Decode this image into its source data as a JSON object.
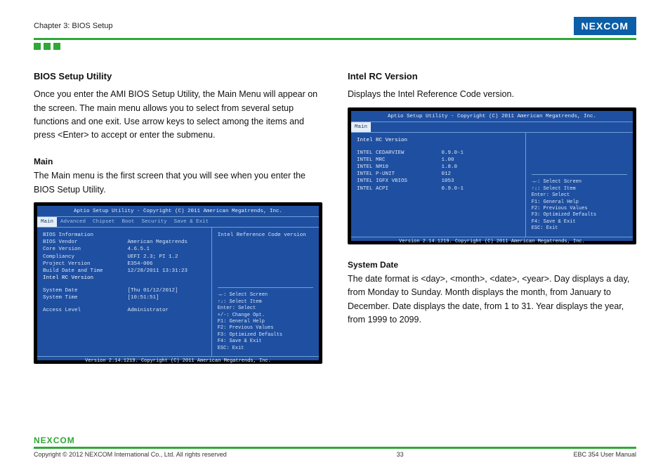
{
  "header": {
    "chapter": "Chapter 3: BIOS Setup",
    "brand": "NE COM",
    "brand_x": "X"
  },
  "left": {
    "title": "BIOS Setup Utility",
    "intro": "Once you enter the AMI BIOS Setup Utility, the Main Menu will appear on the screen. The main menu allows you to select from several setup functions and one exit. Use arrow keys to select among the items and press <Enter> to accept or enter the submenu.",
    "main_h": "Main",
    "main_p": "The Main menu is the first screen that you will see when you enter the BIOS Setup Utility."
  },
  "right": {
    "rc_h": "Intel RC Version",
    "rc_p": "Displays the Intel Reference Code version.",
    "sd_h": "System Date",
    "sd_p": " The date format is <day>, <month>, <date>, <year>. Day displays a day, from Monday to Sunday. Month displays the month, from January to December. Date displays the date, from 1 to 31. Year displays the year, from 1999 to 2099."
  },
  "bios1": {
    "title": "Aptio Setup Utility - Copyright (C) 2011 American Megatrends, Inc.",
    "tabs": [
      "Main",
      "Advanced",
      "Chipset",
      "Boot",
      "Security",
      "Save & Exit"
    ],
    "rows": [
      {
        "k": "BIOS Information",
        "v": ""
      },
      {
        "k": "BIOS Vendor",
        "v": "American Megatrends"
      },
      {
        "k": "Core Version",
        "v": "4.6.5.1"
      },
      {
        "k": "Compliancy",
        "v": "UEFI 2.3; PI 1.2"
      },
      {
        "k": "Project Version",
        "v": "E354-006"
      },
      {
        "k": "Build Date and Time",
        "v": "12/28/2011 13:31:23"
      }
    ],
    "rc_row": {
      "k": "Intel RC Version",
      "v": ""
    },
    "sys_rows": [
      {
        "k": "System Date",
        "v": "[Thu 01/12/2012]"
      },
      {
        "k": "System Time",
        "v": "[10:51:51]"
      }
    ],
    "access": {
      "k": "Access Level",
      "v": "Administrator"
    },
    "right_top": "Intel Reference Code version",
    "help": [
      "→←: Select Screen",
      "↑↓: Select Item",
      "Enter: Select",
      "+/-: Change Opt.",
      "F1: General Help",
      "F2: Previous Values",
      "F3: Optimized Defaults",
      "F4: Save & Exit",
      "ESC: Exit"
    ],
    "footer": "Version 2.14.1219. Copyright (C) 2011 American Megatrends, Inc."
  },
  "bios2": {
    "title": "Aptio Setup Utility - Copyright (C) 2011 American Megatrends, Inc.",
    "tab": "Main",
    "rc_head": "Intel RC Version",
    "rows": [
      {
        "k": "INTEL CEDARVIEW",
        "v": "0.9.0-1"
      },
      {
        "k": "INTEL MRC",
        "v": "1.00"
      },
      {
        "k": "INTEL NM10",
        "v": "1.8.0"
      },
      {
        "k": "INTEL P-UNIT",
        "v": "012"
      },
      {
        "k": "INTEL IGFX VBIOS",
        "v": "1053"
      },
      {
        "k": "INTEL ACPI",
        "v": "0.9.0-1"
      }
    ],
    "help": [
      "→←: Select Screen",
      "↑↓: Select Item",
      "Enter: Select",
      "F1: General Help",
      "F2: Previous Values",
      "F3: Optimized Defaults",
      "F4: Save & Exit",
      "ESC: Exit"
    ],
    "footer": "Version 2.14.1219. Copyright (C) 2011 American Megatrends, Inc."
  },
  "footer": {
    "brand": "NE COM",
    "brand_x": "X",
    "copyright": "Copyright © 2012 NEXCOM International Co., Ltd. All rights reserved",
    "page": "33",
    "doc": "EBC 354 User Manual"
  }
}
